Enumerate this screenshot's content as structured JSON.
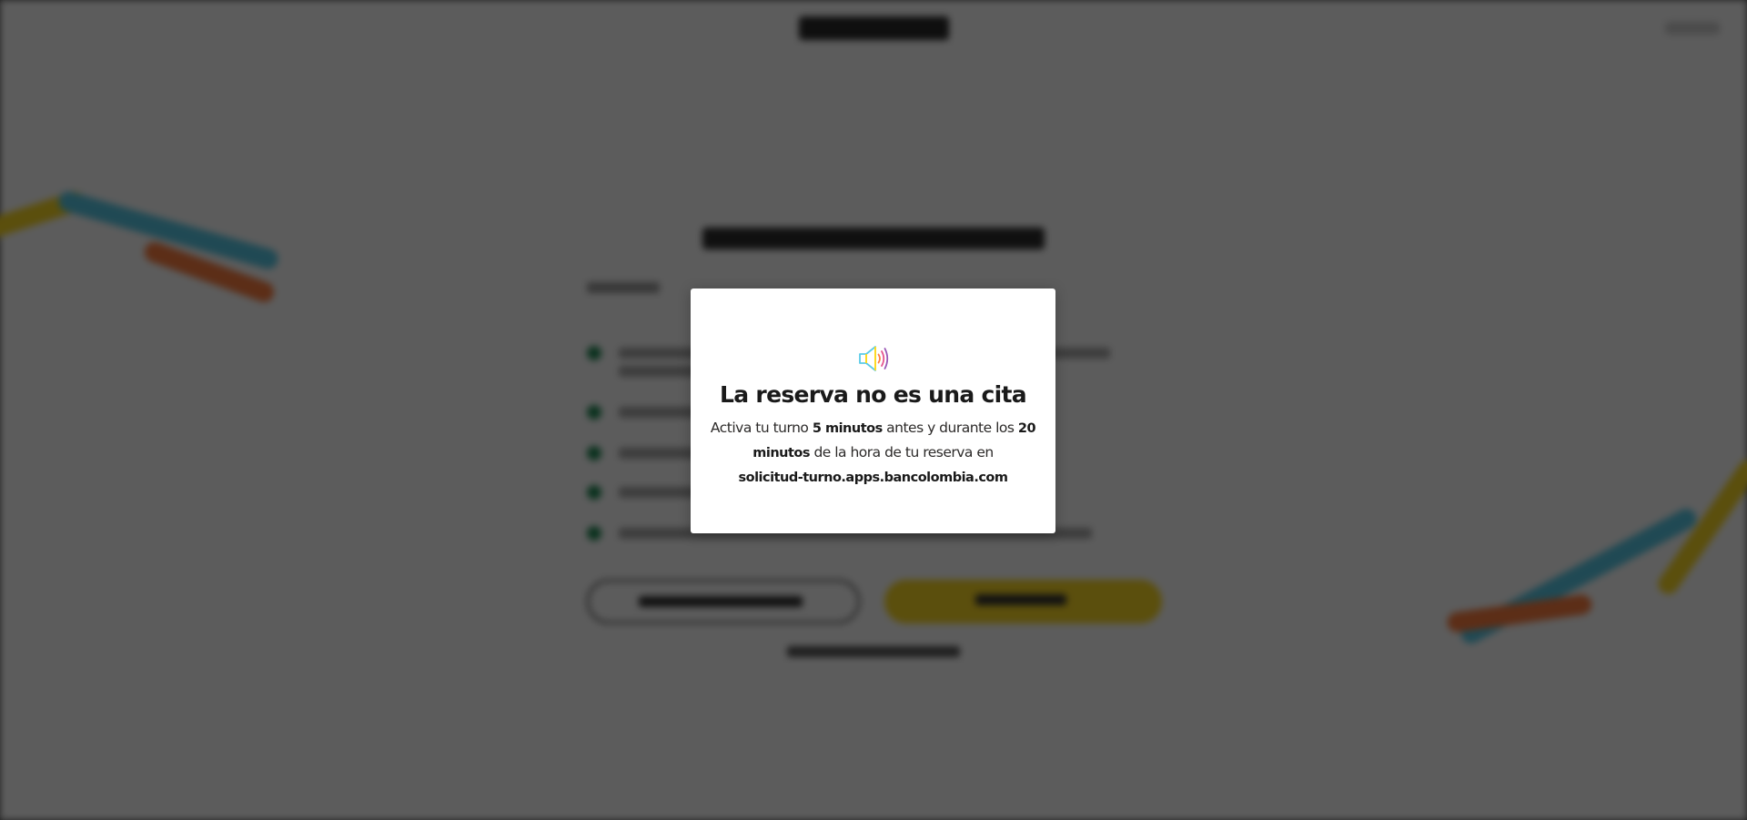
{
  "modal": {
    "title": "La reserva no es una cita",
    "text_1": "Activa tu turno ",
    "text_2": "5 minutos",
    "text_3": " antes y durante los ",
    "text_4": "20 minutos",
    "text_5": " de la hora de tu reserva en",
    "url": "solicitud-turno.apps.bancolombia.com",
    "icon": "speaker-icon"
  },
  "colors": {
    "overlay": "#000000",
    "brand_yellow": "#fdda24",
    "brand_teal": "#00c389",
    "brand_blue": "#59cbe8",
    "brand_orange": "#ff7f41",
    "check_green": "#1f8a55"
  }
}
